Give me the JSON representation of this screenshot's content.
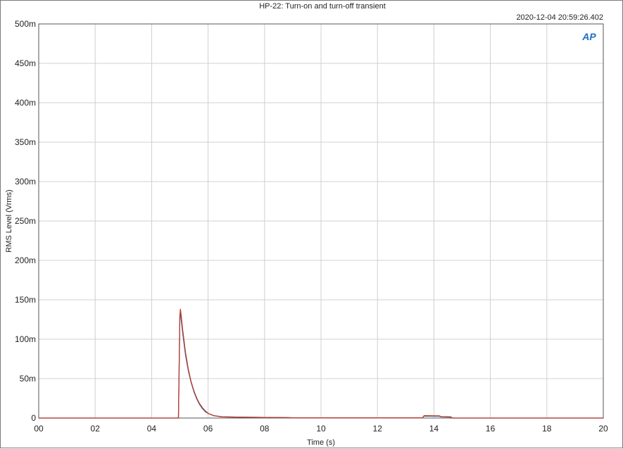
{
  "chart_data": {
    "type": "line",
    "title": "HP-22: Turn-on and turn-off transient",
    "timestamp": "2020-12-04 20:59:26.402",
    "logo_text": "AP",
    "xlabel": "Time (s)",
    "ylabel": "RMS Level (Vrms)",
    "xlim": [
      0,
      20
    ],
    "ylim": [
      0,
      0.5
    ],
    "x_ticks": [
      0,
      2,
      4,
      6,
      8,
      10,
      12,
      14,
      16,
      18,
      20
    ],
    "x_tick_labels": [
      "00",
      "02",
      "04",
      "06",
      "08",
      "10",
      "12",
      "14",
      "16",
      "18",
      "20"
    ],
    "y_ticks": [
      0,
      0.05,
      0.1,
      0.15,
      0.2,
      0.25,
      0.3,
      0.35,
      0.4,
      0.45,
      0.5
    ],
    "y_tick_labels": [
      "0",
      "50m",
      "100m",
      "150m",
      "200m",
      "250m",
      "300m",
      "350m",
      "400m",
      "450m",
      "500m"
    ],
    "grid": true,
    "series": [
      {
        "color": "#1f77b4",
        "x": [
          0,
          4.95,
          5.0,
          5.02,
          5.05,
          5.1,
          5.2,
          5.3,
          5.4,
          5.5,
          5.6,
          5.7,
          5.8,
          5.9,
          6.0,
          6.2,
          6.5,
          7.0,
          8.0,
          8.8,
          9.0,
          12.0,
          13.6,
          13.65,
          14.2,
          14.25,
          14.6,
          14.65,
          20
        ],
        "y": [
          0,
          0,
          0.128,
          0.132,
          0.124,
          0.108,
          0.08,
          0.06,
          0.045,
          0.033,
          0.024,
          0.017,
          0.012,
          0.008,
          0.006,
          0.003,
          0.0015,
          0.0012,
          0.0008,
          0.0005,
          0.0004,
          0.0004,
          0.0004,
          0.0025,
          0.0022,
          0.0015,
          0.0012,
          0,
          0
        ]
      },
      {
        "color": "#c0392b",
        "x": [
          0,
          4.95,
          5.0,
          5.02,
          5.05,
          5.1,
          5.2,
          5.3,
          5.4,
          5.5,
          5.6,
          5.7,
          5.8,
          5.9,
          6.0,
          6.2,
          6.5,
          7.0,
          8.0,
          8.8,
          9.0,
          12.0,
          13.6,
          13.65,
          14.2,
          14.25,
          14.6,
          14.65,
          20
        ],
        "y": [
          0,
          0,
          0.13,
          0.138,
          0.129,
          0.112,
          0.083,
          0.062,
          0.046,
          0.034,
          0.025,
          0.018,
          0.013,
          0.009,
          0.006,
          0.003,
          0.0015,
          0.0012,
          0.0008,
          0.0005,
          0.0004,
          0.0004,
          0.0004,
          0.003,
          0.0028,
          0.0018,
          0.0015,
          0,
          0
        ]
      }
    ]
  }
}
